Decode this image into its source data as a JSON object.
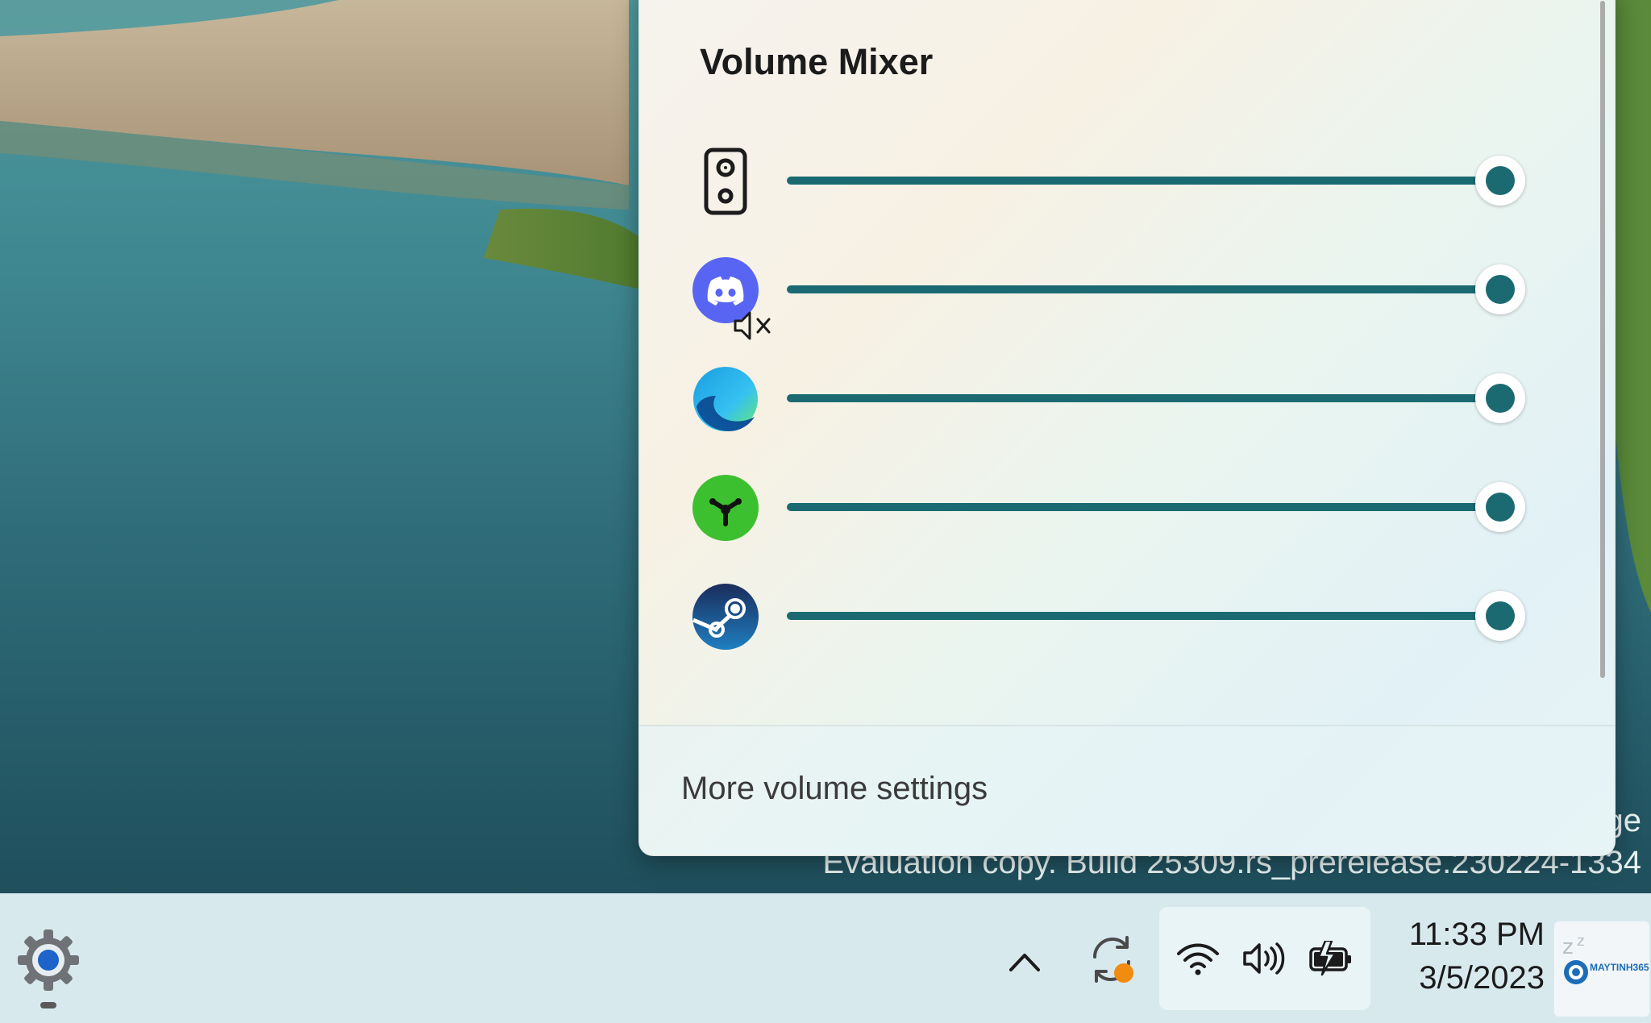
{
  "flyout": {
    "title": "Volume Mixer",
    "footer_link": "More volume settings",
    "rows": [
      {
        "app": "speaker-device",
        "icon": "speaker-icon",
        "volume": 1.0,
        "muted": false
      },
      {
        "app": "discord",
        "icon": "discord-icon",
        "volume": 1.0,
        "muted": true
      },
      {
        "app": "edge",
        "icon": "edge-icon",
        "volume": 1.0,
        "muted": false
      },
      {
        "app": "razer",
        "icon": "razer-icon",
        "volume": 1.0,
        "muted": false
      },
      {
        "app": "steam",
        "icon": "steam-icon",
        "volume": 1.0,
        "muted": false
      }
    ],
    "colors": {
      "accent": "#1b6a72"
    }
  },
  "desktop": {
    "watermark_partial": "ge",
    "watermark": "Evaluation copy. Build 25309.rs_prerelease.230224-1334"
  },
  "taskbar": {
    "time": "11:33 PM",
    "date": "3/5/2023",
    "corner_logo_text": "MAYTINH365"
  }
}
